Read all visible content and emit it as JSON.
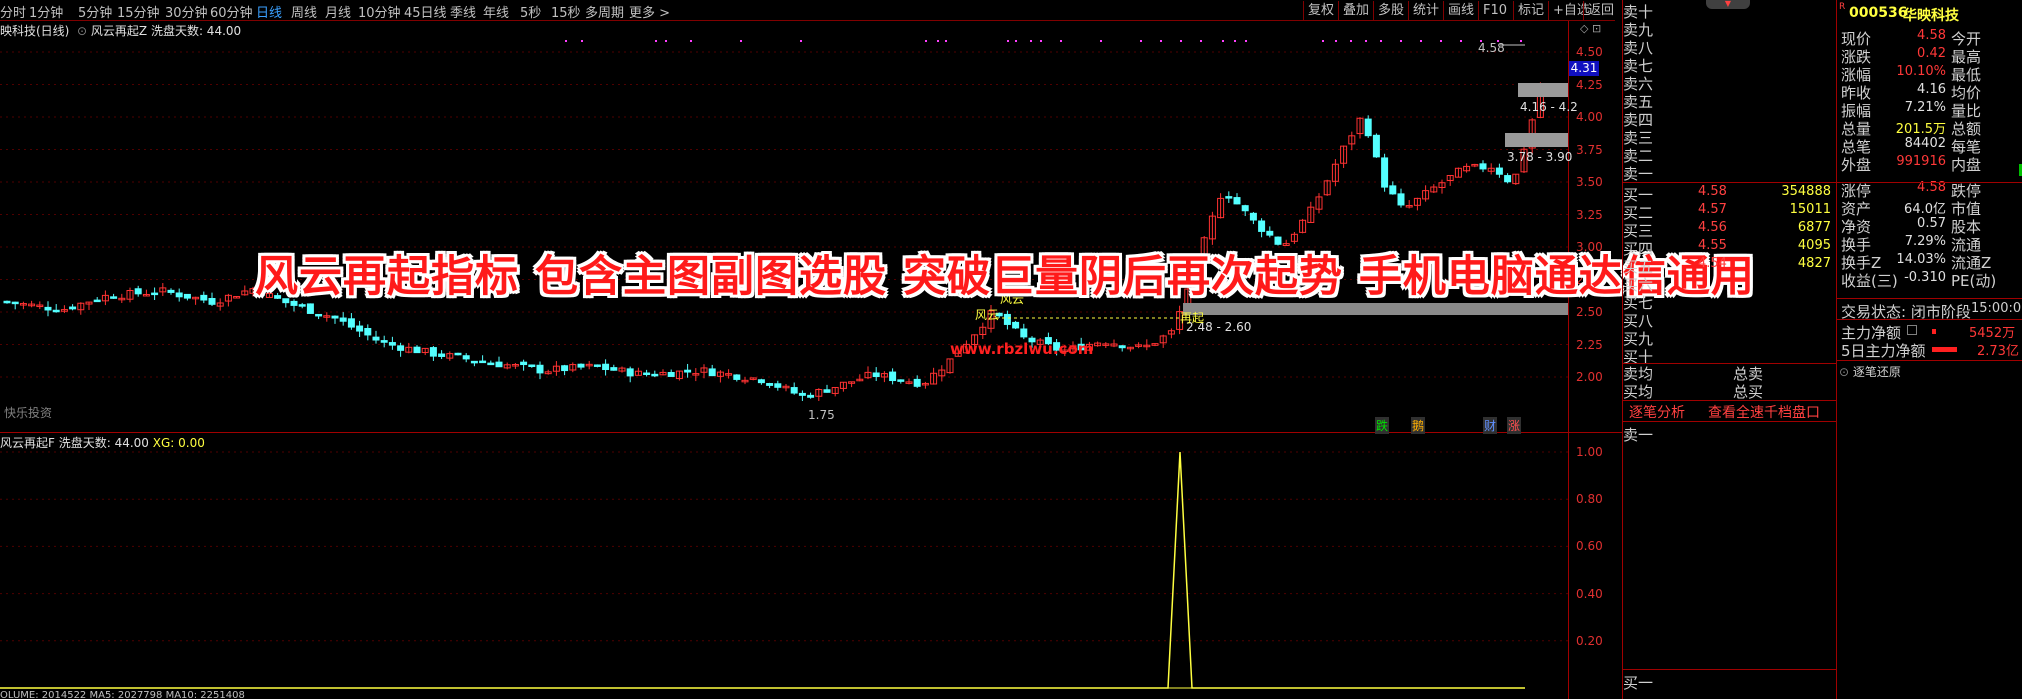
{
  "toolbar": {
    "periods": [
      "分时",
      "1分钟",
      "5分钟",
      "15分钟",
      "30分钟",
      "60分钟",
      "日线",
      "周线",
      "月线",
      "10分钟",
      "45日线",
      "季线",
      "年线",
      "5秒",
      "15秒",
      "多周期",
      "更多 >"
    ],
    "active_period": "日线",
    "buttons": [
      "复权",
      "叠加",
      "多股",
      "统计",
      "画线",
      "F10",
      "标记",
      "+自选",
      "返回"
    ]
  },
  "main_chart": {
    "title_stock": "映科技(日线)",
    "indicator": "风云再起Z",
    "indicator_param": "洗盘天数: 44.00",
    "y_ticks": [
      "4.50",
      "4.25",
      "4.00",
      "3.75",
      "3.50",
      "3.25",
      "3.00",
      "2.75",
      "2.50",
      "2.25",
      "2.00"
    ],
    "current_price_label": "4.31",
    "labels": {
      "high": "4.58",
      "low": "1.75",
      "box1": "4.16 - 4.2",
      "box2": "3.78 - 3.90",
      "box3": "2.48 - 2.60",
      "fengyun1": "风云",
      "fengyun2": "风云",
      "zaiqi": "再起",
      "watermark": "快乐投资",
      "url": "www.rbzlwu.com"
    },
    "event_tags": [
      "跌",
      "鹅",
      "财",
      "涨"
    ]
  },
  "sub_chart": {
    "title": "风云再起F",
    "param": "洗盘天数: 44.00",
    "xg": "XG: 0.00",
    "y_ticks": [
      "1.00",
      "0.80",
      "0.60",
      "0.40",
      "0.20"
    ],
    "bottom_text": "OLUME: 2014522 MA5: 2027798 MA10: 2251408"
  },
  "banner": "风云再起指标 包含主图副图选股 突破巨量阴后再次起势 手机电脑通达信通用",
  "order_book": {
    "sell_labels": [
      "卖十",
      "卖九",
      "卖八",
      "卖七",
      "卖六",
      "卖五",
      "卖四",
      "卖三",
      "卖二",
      "卖一"
    ],
    "buy": [
      {
        "label": "买一",
        "price": "4.58",
        "vol": "354888"
      },
      {
        "label": "买二",
        "price": "4.57",
        "vol": "15011"
      },
      {
        "label": "买三",
        "price": "4.56",
        "vol": "6877"
      },
      {
        "label": "买四",
        "price": "4.55",
        "vol": "4095"
      },
      {
        "label": "买五",
        "price": "4.54",
        "vol": "4827"
      }
    ],
    "buy_labels_rest": [
      "买六",
      "买七",
      "买八",
      "买九",
      "买十"
    ],
    "avg": [
      {
        "label": "卖均",
        "label2": "总卖"
      },
      {
        "label": "买均",
        "label2": "总买"
      }
    ],
    "tabs": [
      "逐笔分析",
      "查看全速千档盘口"
    ],
    "bottom_labels": [
      "卖一",
      "买一"
    ]
  },
  "quote": {
    "code": "000536",
    "name": "华映科技",
    "rows": [
      {
        "l": "现价",
        "v": "4.58",
        "c": "red",
        "l2": "今开"
      },
      {
        "l": "涨跌",
        "v": "0.42",
        "c": "red",
        "l2": "最高"
      },
      {
        "l": "涨幅",
        "v": "10.10%",
        "c": "red",
        "l2": "最低"
      },
      {
        "l": "昨收",
        "v": "4.16",
        "c": "wht",
        "l2": "均价"
      },
      {
        "l": "振幅",
        "v": "7.21%",
        "c": "wht",
        "l2": "量比"
      },
      {
        "l": "总量",
        "v": "201.5万",
        "c": "yel",
        "l2": "总额"
      },
      {
        "l": "总笔",
        "v": "84402",
        "c": "wht",
        "l2": "每笔"
      },
      {
        "l": "外盘",
        "v": "991916",
        "c": "red",
        "l2": "内盘"
      },
      {
        "l": "涨停",
        "v": "4.58",
        "c": "red",
        "l2": "跌停"
      },
      {
        "l": "资产",
        "v": "64.0亿",
        "c": "wht",
        "l2": "市值"
      },
      {
        "l": "净资",
        "v": "0.57",
        "c": "wht",
        "l2": "股本"
      },
      {
        "l": "换手",
        "v": "7.29%",
        "c": "wht",
        "l2": "流通"
      },
      {
        "l": "换手Z",
        "v": "14.03%",
        "c": "wht",
        "l2": "流通Z"
      },
      {
        "l": "收益(三)",
        "v": "-0.310",
        "c": "wht",
        "l2": "PE(动)"
      }
    ],
    "status_label": "交易状态: 闭市阶段",
    "status_time": "15:00:0",
    "flow1_label": "主力净额",
    "flow1_value": "5452万",
    "flow2_label": "5日主力净额",
    "flow2_value": "2.73亿",
    "replay": "逐笔还原"
  },
  "colors": {
    "up": "#ff3232",
    "down": "#54ffff",
    "frame": "#a00000",
    "price": "#ff3838",
    "volume": "#ffff40"
  }
}
